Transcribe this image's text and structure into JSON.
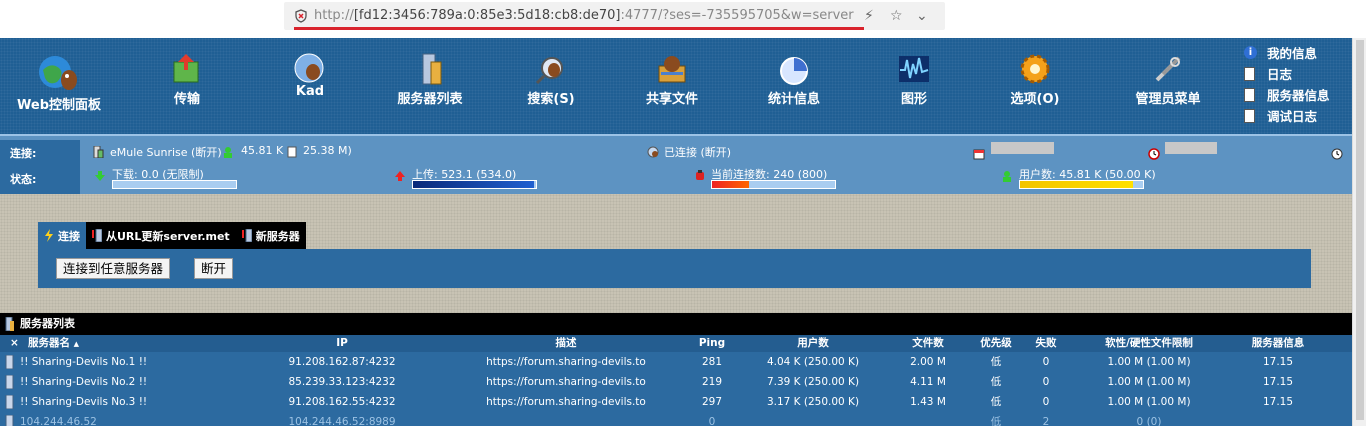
{
  "browser": {
    "url_prefix": "http://",
    "url_host": "[fd12:3456:789a:0:85e3:5d18:cb8:de70]",
    "url_rest": ":4777/?ses=-735595705&w=server"
  },
  "nav": {
    "items": [
      {
        "label": "Web控制面板",
        "icon": "mule-globe-icon"
      },
      {
        "label": "传输",
        "icon": "transfer-icon"
      },
      {
        "label": "Kad",
        "icon": "kad-icon"
      },
      {
        "label": "服务器列表",
        "icon": "server-list-icon"
      },
      {
        "label": "搜索(S)",
        "icon": "search-icon"
      },
      {
        "label": "共享文件",
        "icon": "shared-files-icon"
      },
      {
        "label": "统计信息",
        "icon": "statistics-icon"
      },
      {
        "label": "图形",
        "icon": "graph-icon"
      },
      {
        "label": "选项(O)",
        "icon": "options-icon"
      },
      {
        "label": "管理员菜单",
        "icon": "admin-tools-icon"
      }
    ],
    "side": [
      "我的信息",
      "日志",
      "服务器信息",
      "调试日志"
    ]
  },
  "status": {
    "label_connection": "连接:",
    "label_state": "状态:",
    "server_name": "eMule Sunrise (断开)",
    "users": "45.81 K",
    "files": "25.38 M)",
    "kad_status": "已连接 (断开)",
    "download": "下载: 0.0 (无限制)",
    "upload": "上传: 523.1 (534.0)",
    "connections": "当前连接数: 240 (800)",
    "user_count": "用户数: 45.81 K (50.00 K)",
    "download_fraction": 0.0,
    "upload_fraction": 0.98,
    "connections_fraction": 0.3,
    "users_fraction": 0.92
  },
  "tabs": [
    {
      "label": "连接",
      "active": true
    },
    {
      "label": "从URL更新server.met",
      "active": false
    },
    {
      "label": "新服务器",
      "active": false
    }
  ],
  "buttons": {
    "connect_any": "连接到任意服务器",
    "disconnect": "断开"
  },
  "server_list": {
    "title": "服务器列表",
    "columns": [
      "服务器名",
      "IP",
      "描述",
      "Ping",
      "用户数",
      "文件数",
      "优先级",
      "失败",
      "软性/硬性文件限制",
      "服务器信息"
    ],
    "close_symbol": "×",
    "sort_arrow": "▲",
    "rows": [
      {
        "name": "!! Sharing-Devils No.1 !!",
        "ip": "91.208.162.87:4232",
        "desc": "https://forum.sharing-devils.to",
        "ping": "281",
        "users": "4.04 K (250.00 K)",
        "files": "2.00 M",
        "priority": "低",
        "fail": "0",
        "limit": "1.00 M (1.00 M)",
        "info": "17.15"
      },
      {
        "name": "!! Sharing-Devils No.2 !!",
        "ip": "85.239.33.123:4232",
        "desc": "https://forum.sharing-devils.to",
        "ping": "219",
        "users": "7.39 K (250.00 K)",
        "files": "4.11 M",
        "priority": "低",
        "fail": "0",
        "limit": "1.00 M (1.00 M)",
        "info": "17.15"
      },
      {
        "name": "!! Sharing-Devils No.3 !!",
        "ip": "91.208.162.55:4232",
        "desc": "https://forum.sharing-devils.to",
        "ping": "297",
        "users": "3.17 K (250.00 K)",
        "files": "1.43 M",
        "priority": "低",
        "fail": "0",
        "limit": "1.00 M (1.00 M)",
        "info": "17.15"
      },
      {
        "name": "104.244.46.52",
        "ip": "104.244.46.52:8989",
        "desc": "",
        "ping": "0",
        "users": "",
        "files": "",
        "priority": "低",
        "fail": "2",
        "limit": "0 (0)",
        "info": ""
      }
    ]
  }
}
